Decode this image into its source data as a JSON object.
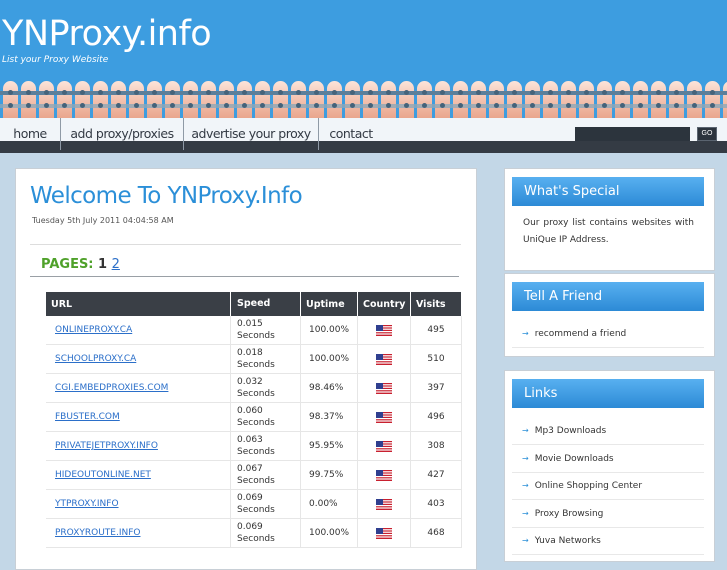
{
  "site": {
    "title": "YNProxy.info",
    "tagline": "List your Proxy Website"
  },
  "nav": {
    "items": [
      "home",
      "add proxy/proxies",
      "advertise your proxy",
      "contact"
    ],
    "search_value": "",
    "go_label": "GO"
  },
  "main": {
    "title": "Welcome To YNProxy.Info",
    "date": "Tuesday 5th July 2011 04:04:58 AM",
    "pages_label": "PAGES:",
    "pages": [
      "1",
      "2"
    ],
    "table": {
      "headers": [
        "URL",
        "Speed",
        "Uptime",
        "Country",
        "Visits"
      ],
      "rows": [
        {
          "url": "ONLINEPROXY.CA",
          "speed": "0.015 Seconds",
          "uptime": "100.00%",
          "visits": "495"
        },
        {
          "url": "SCHOOLPROXY.CA",
          "speed": "0.018 Seconds",
          "uptime": "100.00%",
          "visits": "510"
        },
        {
          "url": "CGI.EMBEDPROXIES.COM",
          "speed": "0.032 Seconds",
          "uptime": "98.46%",
          "visits": "397"
        },
        {
          "url": "FBUSTER.COM",
          "speed": "0.060 Seconds",
          "uptime": "98.37%",
          "visits": "496"
        },
        {
          "url": "PRIVATEJETPROXY.INFO",
          "speed": "0.063 Seconds",
          "uptime": "95.95%",
          "visits": "308"
        },
        {
          "url": "HIDEOUTONLINE.NET",
          "speed": "0.067 Seconds",
          "uptime": "99.75%",
          "visits": "427"
        },
        {
          "url": "YTPROXY.INFO",
          "speed": "0.069 Seconds",
          "uptime": "0.00%",
          "visits": "403"
        },
        {
          "url": "PROXYROUTE.INFO",
          "speed": "0.069 Seconds",
          "uptime": "100.00%",
          "visits": "468"
        }
      ],
      "country_icon": "us-flag-icon"
    }
  },
  "sidebar": {
    "special": {
      "title": "What's Special",
      "text": "Our proxy list contains websites with UniQue IP Address."
    },
    "friend": {
      "title": "Tell A Friend",
      "link": "recommend a friend"
    },
    "links": {
      "title": "Links",
      "items": [
        "Mp3 Downloads",
        "Movie Downloads",
        "Online Shopping Center",
        "Proxy Browsing",
        "Yuva Networks"
      ]
    }
  },
  "colors": {
    "header_blue": "#3d9de0",
    "title_blue": "#2b8fd8",
    "pages_green": "#4fa12a",
    "table_header": "#3a3f46",
    "link_blue": "#2b6fc9"
  }
}
